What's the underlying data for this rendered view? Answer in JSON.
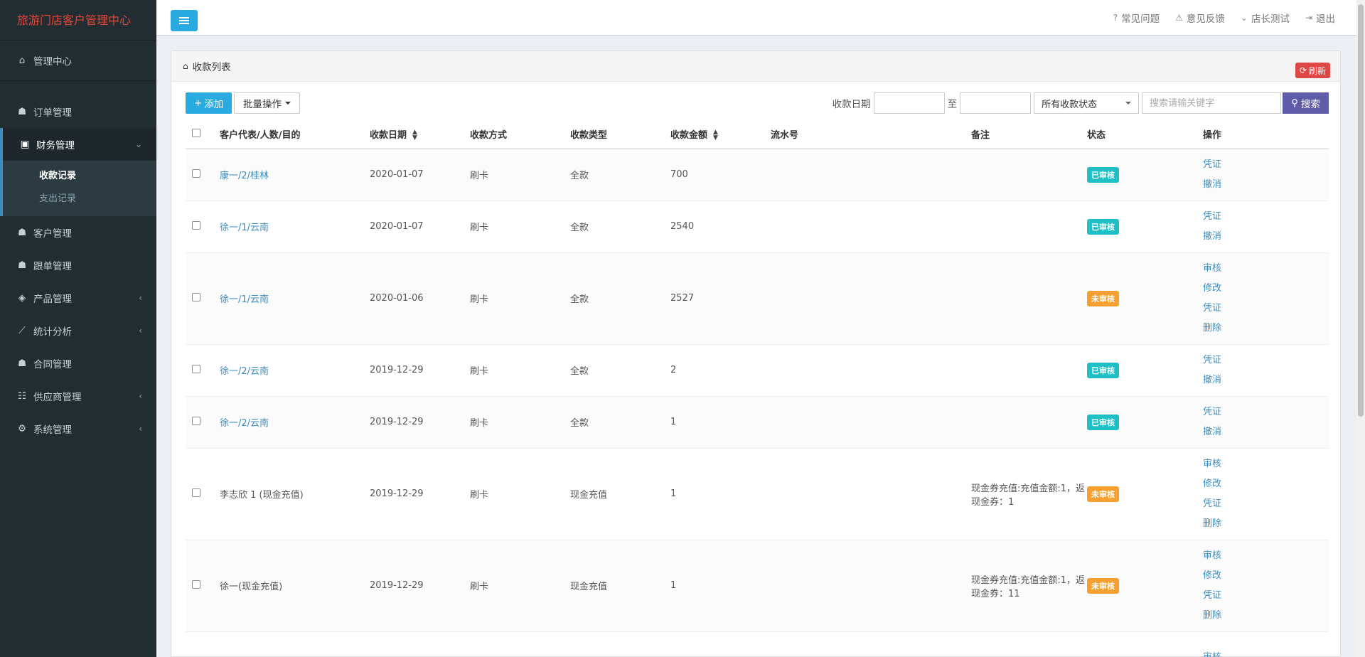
{
  "app": {
    "title": "旅游门店客户管理中心"
  },
  "sidebar": {
    "items": [
      {
        "label": "管理中心",
        "icon": "home-icon"
      },
      {
        "label": "订单管理",
        "icon": "user-icon"
      },
      {
        "label": "财务管理",
        "icon": "money-icon",
        "active": true
      },
      {
        "label": "客户管理",
        "icon": "user-icon"
      },
      {
        "label": "跟单管理",
        "icon": "user-icon"
      },
      {
        "label": "产品管理",
        "icon": "cube-icon"
      },
      {
        "label": "统计分析",
        "icon": "chart-icon"
      },
      {
        "label": "合同管理",
        "icon": "user-icon"
      },
      {
        "label": "供应商管理",
        "icon": "users-icon"
      },
      {
        "label": "系统管理",
        "icon": "cogs-icon"
      }
    ],
    "submenu": [
      {
        "label": "收款记录"
      },
      {
        "label": "支出记录"
      }
    ]
  },
  "topbar": {
    "links": [
      {
        "label": "常见问题",
        "icon": "question-icon"
      },
      {
        "label": "意见反馈",
        "icon": "warning-icon"
      },
      {
        "label": "店长测试",
        "icon": "chevron-down-icon"
      },
      {
        "label": "退出",
        "icon": "sign-out-icon"
      }
    ]
  },
  "panel": {
    "title": "收款列表",
    "refresh_label": "刷新"
  },
  "toolbar": {
    "add_label": "添加",
    "batch_label": "批量操作",
    "date_label": "收款日期",
    "to_label": "至",
    "status_select": "所有收款状态",
    "search_placeholder": "搜索请输关键字",
    "search_label": "搜索"
  },
  "table": {
    "columns": [
      "客户代表/人数/目的",
      "收款日期",
      "收款方式",
      "收款类型",
      "收款金额",
      "流水号",
      "备注",
      "状态",
      "操作"
    ],
    "rows": [
      {
        "customer": "康一/2/桂林",
        "link": true,
        "date": "2020-01-07",
        "method": "刷卡",
        "type": "全款",
        "amount": "700",
        "serial": "",
        "note": "",
        "status": "已审核",
        "ops": [
          "凭证",
          "撤消"
        ]
      },
      {
        "customer": "徐一/1/云南",
        "link": true,
        "date": "2020-01-07",
        "method": "刷卡",
        "type": "全款",
        "amount": "2540",
        "serial": "",
        "note": "",
        "status": "已审核",
        "ops": [
          "凭证",
          "撤消"
        ]
      },
      {
        "customer": "徐一/1/云南",
        "link": true,
        "date": "2020-01-06",
        "method": "刷卡",
        "type": "全款",
        "amount": "2527",
        "serial": "",
        "note": "",
        "status": "未审核",
        "ops": [
          "审核",
          "修改",
          "凭证",
          "删除"
        ]
      },
      {
        "customer": "徐一/2/云南",
        "link": true,
        "date": "2019-12-29",
        "method": "刷卡",
        "type": "全款",
        "amount": "2",
        "serial": "",
        "note": "",
        "status": "已审核",
        "ops": [
          "凭证",
          "撤消"
        ]
      },
      {
        "customer": "徐一/2/云南",
        "link": true,
        "date": "2019-12-29",
        "method": "刷卡",
        "type": "全款",
        "amount": "1",
        "serial": "",
        "note": "",
        "status": "已审核",
        "ops": [
          "凭证",
          "撤消"
        ]
      },
      {
        "customer": "李志欣 1 (现金充值)",
        "link": false,
        "date": "2019-12-29",
        "method": "刷卡",
        "type": "现金充值",
        "amount": "1",
        "serial": "",
        "note": "现金券充值:充值金额:1，返现金券：1",
        "status": "未审核",
        "ops": [
          "审核",
          "修改",
          "凭证",
          "删除"
        ]
      },
      {
        "customer": "徐一(现金充值)",
        "link": false,
        "date": "2019-12-29",
        "method": "刷卡",
        "type": "现金充值",
        "amount": "1",
        "serial": "",
        "note": "现金券充值:充值金额:1，返现金券：11",
        "status": "未审核",
        "ops": [
          "审核",
          "修改",
          "凭证",
          "删除"
        ]
      },
      {
        "customer": "",
        "link": false,
        "date": "",
        "method": "",
        "type": "",
        "amount": "",
        "serial": "",
        "note": "",
        "status": "",
        "ops": [
          "审核"
        ]
      }
    ]
  },
  "colors": {
    "accent": "#29aae1",
    "purple": "#605ca8",
    "approved": "#1fc0c5",
    "pending": "#f5a030",
    "danger": "#e04848",
    "sidebar": "#222d32"
  }
}
